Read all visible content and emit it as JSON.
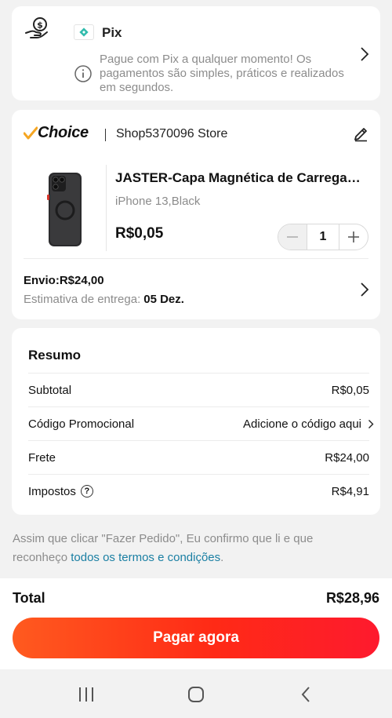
{
  "payment": {
    "method_name": "Pix",
    "note": "Pague com Pix a qualquer momento! Os pagamentos são simples, práticos e realizados em segundos.",
    "icons": [
      "hand-money-icon",
      "pix-logo-icon",
      "info-icon",
      "chevron-right-icon"
    ]
  },
  "store": {
    "brand_label": "Choice",
    "separator": "|",
    "name": "Shop5370096 Store",
    "product": {
      "title": "JASTER-Capa Magnética de Carregamento Sem Fio",
      "variant": "iPhone 13,Black",
      "price": "R$0,05",
      "quantity": "1"
    },
    "shipping": {
      "title": "Envio:R$24,00",
      "eta_label": "Estimativa de entrega:",
      "eta_value": "05 Dez."
    }
  },
  "summary": {
    "title": "Resumo",
    "rows": [
      {
        "label": "Subtotal",
        "value": "R$0,05"
      },
      {
        "label": "Código Promocional",
        "value": "Adicione o código aqui"
      },
      {
        "label": "Frete",
        "value": "R$24,00"
      },
      {
        "label": "Impostos",
        "value": "R$4,91"
      }
    ]
  },
  "disclaimer": {
    "text": "Assim que clicar \"Fazer Pedido\", Eu confirmo que li e que reconheço ",
    "link": "todos os termos e condições",
    "end": "."
  },
  "footer": {
    "total_label": "Total",
    "total_value": "R$28,96",
    "pay_button": "Pagar agora"
  },
  "colors": {
    "accent": "#ff3a1a",
    "pix": "#32bcad",
    "choice_check": "#f5a623",
    "link": "#1a7fa3"
  }
}
